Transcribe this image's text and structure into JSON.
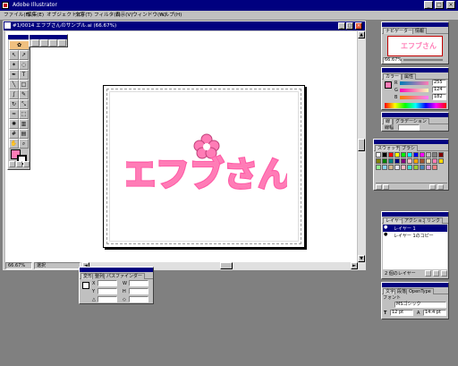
{
  "app": {
    "title": "Adobe Illustrator",
    "win_buttons": {
      "minimize": "_",
      "maximize": "□",
      "close": "×"
    }
  },
  "menu": [
    "ファイル(F)",
    "編集(E)",
    "オブジェクト(O)",
    "文字(T)",
    "フィルタ(L)",
    "表示(V)",
    "ウィンドウ(W)",
    "ヘルプ(H)"
  ],
  "document": {
    "title": "#1/0014 エフブさんのサンプル.ai (66.67%)",
    "zoom_label": "66.67%",
    "status_label": "選択",
    "logo_text": "エフブさん"
  },
  "navigator": {
    "tabs": [
      "ナビゲーター",
      "情報"
    ],
    "zoom_value": "66.67%",
    "thumb_text": "エフブさん"
  },
  "color_panel": {
    "tabs": [
      "カラー",
      "属性"
    ],
    "rows": [
      {
        "label": "R",
        "value": "255",
        "fill": 1.0
      },
      {
        "label": "G",
        "value": "124",
        "fill": 0.49
      },
      {
        "label": "B",
        "value": "182",
        "fill": 0.71
      }
    ],
    "fill_color": "#ff7cb6"
  },
  "stroke_panel": {
    "tabs": [
      "線",
      "グラデーション"
    ],
    "weight_label": "線幅"
  },
  "swatch_panel": {
    "tabs": [
      "スウォッチ",
      "ブラシ"
    ],
    "colors": [
      "#ffffff",
      "#000000",
      "#ff0000",
      "#ffff00",
      "#00ff00",
      "#00ffff",
      "#0000ff",
      "#ff00ff",
      "#c0c0c0",
      "#808080",
      "#800000",
      "#808000",
      "#008000",
      "#008080",
      "#000080",
      "#800080",
      "#ffc0cb",
      "#ffa500",
      "#a0522d",
      "#f5deb3",
      "#ff7cb6",
      "#ffd700",
      "#90ee90",
      "#87ceeb",
      "#d2b48c",
      "#e6e6fa",
      "#ffb6c1",
      "#40e0d0",
      "#9acd32",
      "#4682b4",
      "#dda0dd",
      "#f08080"
    ]
  },
  "layers_panel": {
    "tabs": [
      "レイヤー",
      "アクション",
      "リンク"
    ],
    "layers": [
      "レイヤー 1",
      "レイヤー 1のコピー"
    ],
    "footer": "2 個のレイヤー"
  },
  "transform_panel": {
    "tabs": [
      "変形",
      "整列",
      "パスファインダー"
    ],
    "fields": [
      {
        "label": "X",
        "value": ""
      },
      {
        "label": "W",
        "value": ""
      },
      {
        "label": "Y",
        "value": ""
      },
      {
        "label": "H",
        "value": ""
      }
    ]
  },
  "char_panel": {
    "tabs": [
      "文字",
      "段落",
      "OpenType"
    ],
    "font_label": "フォント",
    "font": "MSゴシック",
    "size": "12 pt",
    "leading": "14.4 pt"
  },
  "colors": {
    "titlebar": "#00007f",
    "chrome": "#c0c0c0",
    "logo_pink": "#ff7cb6",
    "logo_light": "#ffd6ea"
  }
}
